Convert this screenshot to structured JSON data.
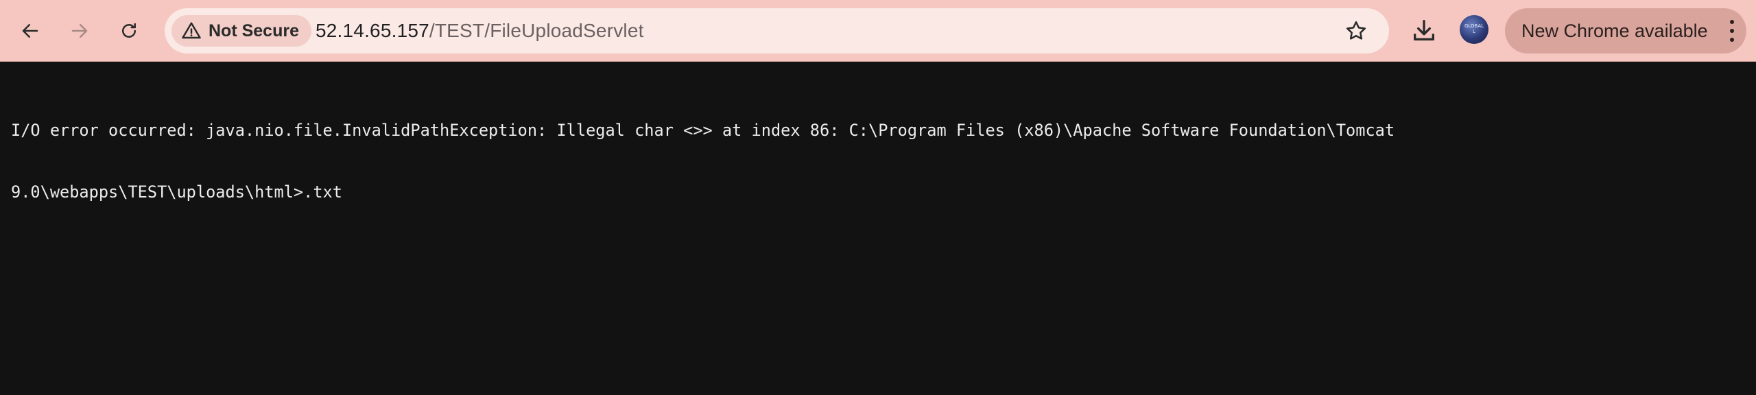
{
  "browser": {
    "security_label": "Not Secure",
    "url_host": "52.14.65.157",
    "url_path": "/TEST/FileUploadServlet",
    "update_label": "New Chrome available",
    "avatar_text_line1": "GLOBAL",
    "avatar_text_line2": "L",
    "icons": {
      "back": "arrow-left-icon",
      "forward": "arrow-right-icon",
      "reload": "reload-icon",
      "warning": "warning-triangle-icon",
      "bookmark": "star-icon",
      "downloads": "download-icon",
      "menu": "kebab-menu-icon"
    },
    "colors": {
      "toolbar": "#f5c7c0",
      "omnibox": "#fbe9e6",
      "update_pill": "#d9a49c",
      "page_background": "#121212"
    }
  },
  "page": {
    "error_line1": "I/O error occurred: java.nio.file.InvalidPathException: Illegal char <>> at index 86: C:\\Program Files (x86)\\Apache Software Foundation\\Tomcat",
    "error_line2": "9.0\\webapps\\TEST\\uploads\\html>.txt"
  }
}
